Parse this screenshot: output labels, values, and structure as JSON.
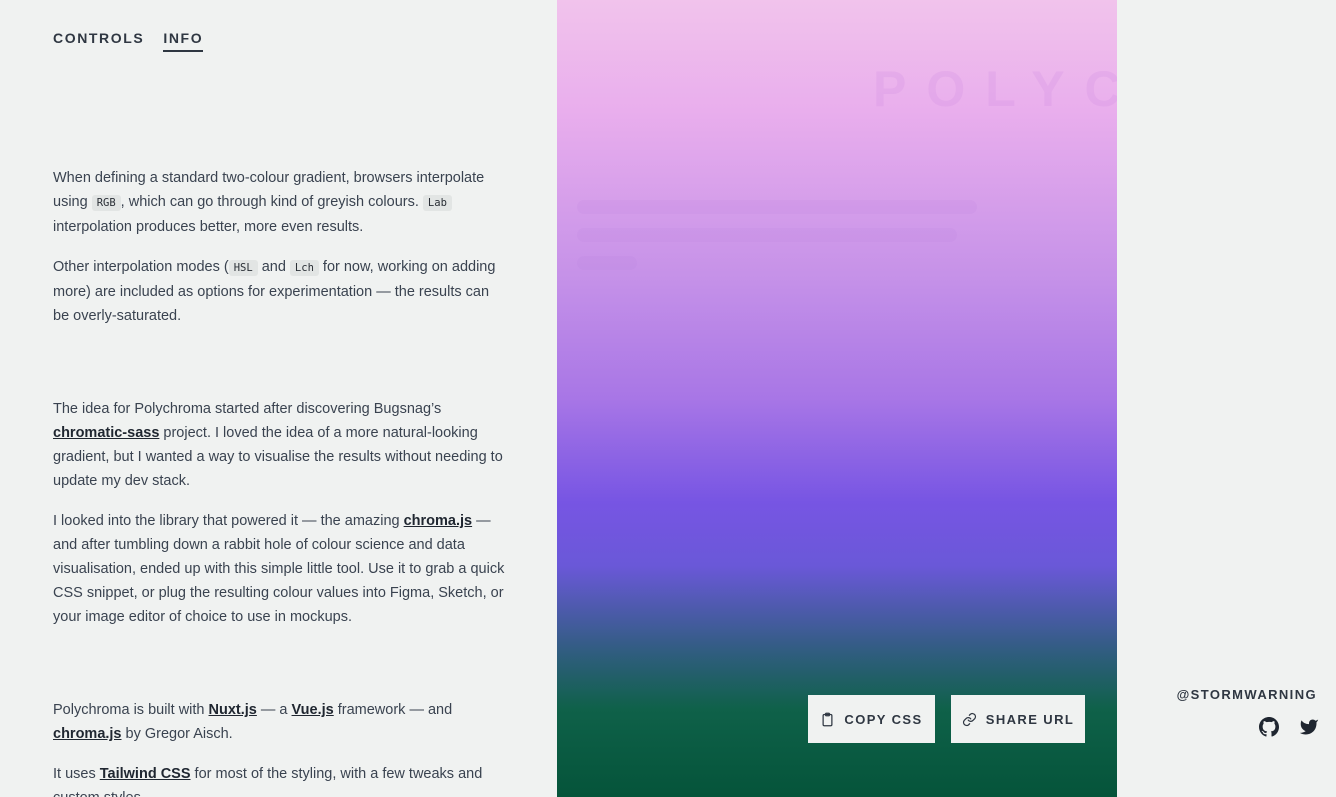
{
  "tabs": [
    {
      "label": "CONTROLS",
      "active": false
    },
    {
      "label": "INFO",
      "active": true
    }
  ],
  "info": {
    "p1_a": "When defining a standard two-colour gradient, browsers interpolate using ",
    "p1_code1": "RGB",
    "p1_b": ", which can go through kind of greyish colours. ",
    "p1_code2": "Lab",
    "p1_c": " interpolation produces better, more even results.",
    "p2_a": "Other interpolation modes (",
    "p2_code1": "HSL",
    "p2_b": " and ",
    "p2_code2": "Lch",
    "p2_c": " for now, working on adding more) are included as options for experimentation — the results can be overly-saturated.",
    "p3_a": "The idea for Polychroma started after discovering Bugsnag’s ",
    "p3_link": "chromatic-sass",
    "p3_b": " project. I loved the idea of a more natural-looking gradient, but I wanted a way to visualise the results without needing to update my dev stack.",
    "p4_a": "I looked into the library that powered it — the amazing ",
    "p4_link": "chroma.js",
    "p4_b": " — and after tumbling down a rabbit hole of colour science and data visualisation, ended up with this simple little tool. Use it to grab a quick CSS snippet, or plug the resulting colour values into Figma, Sketch, or your image editor of choice to use in mockups.",
    "p5_a": "Polychroma is built with ",
    "p5_link1": "Nuxt.js",
    "p5_b": " — a ",
    "p5_link2": "Vue.js",
    "p5_c": " framework — and ",
    "p5_link3": "chroma.js",
    "p5_d": " by Gregor Aisch.",
    "p6_a": "It uses ",
    "p6_link": "Tailwind CSS",
    "p6_b": " for most of the styling, with a few tweaks and custom styles."
  },
  "preview": {
    "ghost_title": "POLYCH",
    "colors": [
      "#f1c3ec",
      "#c591e8",
      "#7755e3",
      "#0f6149",
      "#05543a"
    ]
  },
  "actions": {
    "copy_label": "COPY CSS",
    "share_label": "SHARE URL"
  },
  "footer": {
    "handle": "@STORMWARNING",
    "icons": [
      "github-icon",
      "twitter-icon"
    ]
  }
}
